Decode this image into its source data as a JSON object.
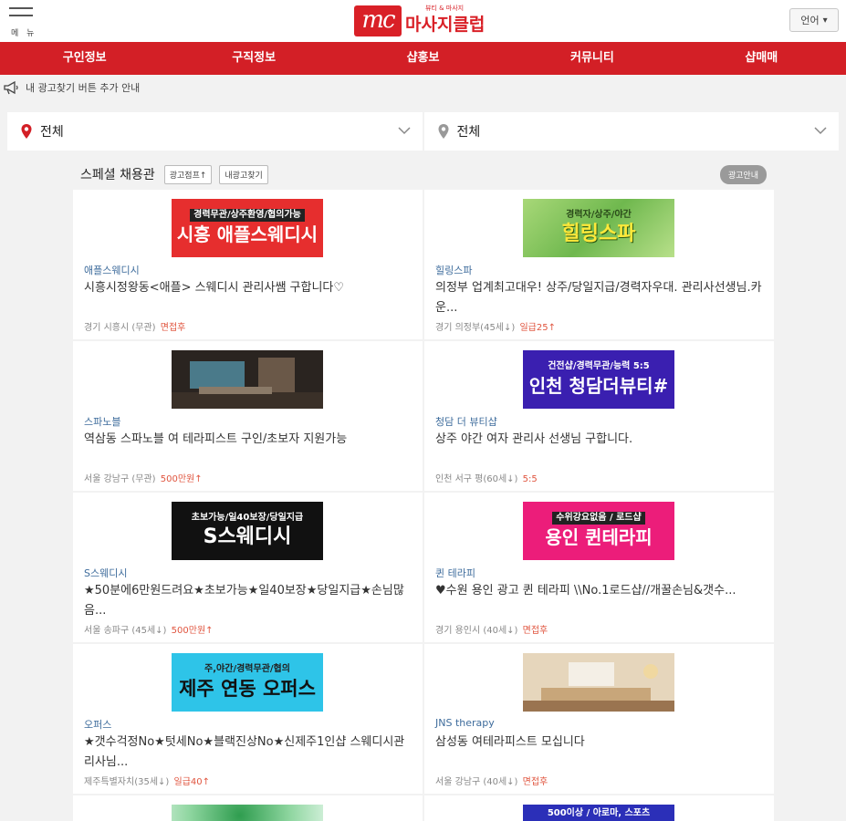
{
  "header": {
    "menu_label": "메 뉴",
    "logo_mark": "mc",
    "logo_sub": "뷰티 & 마사지",
    "logo_name": "마사지클럽",
    "lang_label": "언어"
  },
  "nav": [
    "구인정보",
    "구직정보",
    "샵홍보",
    "커뮤니티",
    "샵매매"
  ],
  "notice": "내 광고찾기 버튼 추가 안내",
  "region": {
    "left": "전체",
    "right": "전체"
  },
  "section": {
    "title": "스페셜 채용관",
    "btn_jump": "광고점프↑",
    "btn_find": "내광고찾기",
    "ad_info": "광고안내"
  },
  "cards": [
    {
      "banner_top": "경력무관/상주환영/협의가능",
      "banner_main": "시흥 애플스웨디시",
      "name": "애플스웨디시",
      "desc": "시흥시정왕동<애플> 스웨디시 관리사쌤 구합니다♡",
      "meta": "경기 시흥시 (무관)",
      "pay": "면접후"
    },
    {
      "banner_top": "경력자/상주/야간",
      "banner_main": "힐링스파",
      "name": "힐링스파",
      "desc": "의정부 업계최고대우! 상주/당일지급/경력자우대. 관리사선생님.카운...",
      "meta": "경기 의정부(45세↓)",
      "pay": "일급25↑"
    },
    {
      "banner_top": "",
      "banner_main": "",
      "name": "스파노블",
      "desc": "역삼동 스파노블 여 테라피스트 구인/초보자 지원가능",
      "meta": "서울 강남구 (무관)",
      "pay": "500만원↑"
    },
    {
      "banner_top": "건전샵/경력무관/능력 5:5",
      "banner_main": "인천 청담더뷰티#",
      "name": "청담 더 뷰티샵",
      "desc": "상주 야간 여자 관리사 선생님 구합니다.",
      "meta": "인천 서구 평(60세↓)",
      "pay": "5:5"
    },
    {
      "banner_top": "초보가능/일40보장/당일지급",
      "banner_main": "S스웨디시",
      "name": "S스웨디시",
      "desc": "★50분에6만원드려요★초보가능★일40보장★당일지급★손님많음...",
      "meta": "서울 송파구 (45세↓)",
      "pay": "500만원↑"
    },
    {
      "banner_top": "수위강요없음 / 로드샵",
      "banner_main": "용인 퀸테라피",
      "name": "퀸 테라피",
      "desc": "♥수원 용인 광고 퀸 테라피 \\\\No.1로드샵//개꿀손님&갯수...",
      "meta": "경기 용인시 (40세↓)",
      "pay": "면접후"
    },
    {
      "banner_top": "주,야간/경력무관/협의",
      "banner_main": "제주 연동 오퍼스",
      "name": "오퍼스",
      "desc": "★갯수걱정No★텃세No★블랙진상No★신제주1인샵 스웨디시관리사님...",
      "meta": "제주특별자치(35세↓)",
      "pay": "일급40↑"
    },
    {
      "banner_top": "",
      "banner_main": "",
      "name": "JNS therapy",
      "desc": "삼성동 여테라피스트 모십니다",
      "meta": "서울 강남구 (40세↓)",
      "pay": "면접후"
    },
    {
      "banner_top": "",
      "banner_main": ""
    },
    {
      "banner_top": "500이상 / 아로마, 스포츠",
      "banner_main": ""
    }
  ]
}
